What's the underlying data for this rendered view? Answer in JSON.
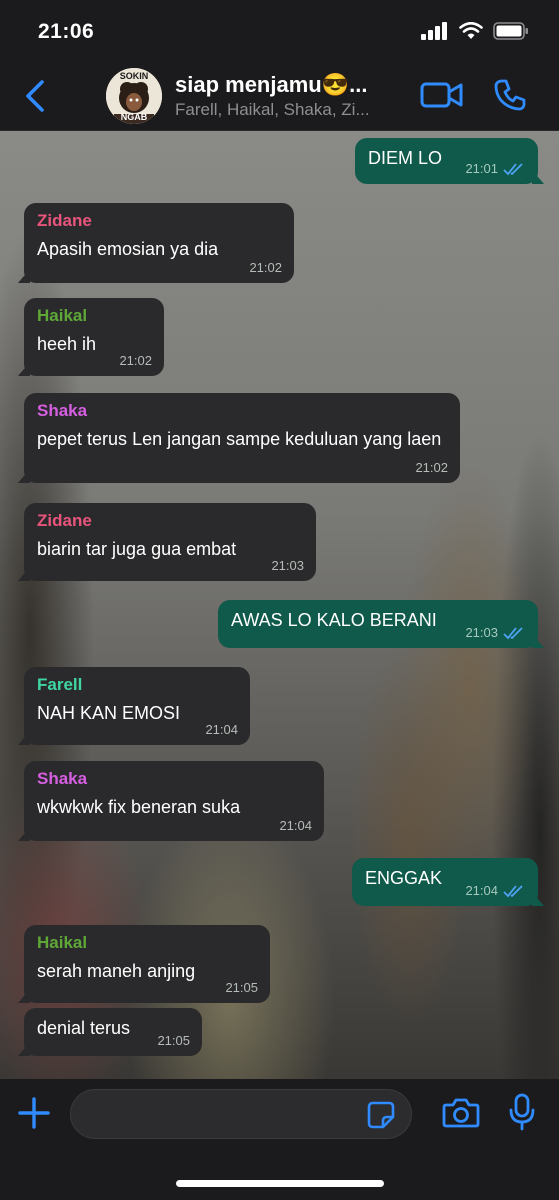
{
  "status": {
    "time": "21:06"
  },
  "header": {
    "title": "siap menjamu😎...",
    "subtitle": "Farell, Haikal, Shaka, Zi...",
    "avatar_text_top": "SOKIN",
    "avatar_text_bottom": "NGAB"
  },
  "messages": [
    {
      "direction": "out",
      "text": "DIEM LO",
      "time": "21:01"
    },
    {
      "direction": "in",
      "sender": "Zidane",
      "text": "Apasih emosian ya dia",
      "time": "21:02"
    },
    {
      "direction": "in",
      "sender": "Haikal",
      "text": "heeh ih",
      "time": "21:02"
    },
    {
      "direction": "in",
      "sender": "Shaka",
      "text": "pepet terus Len jangan sampe keduluan yang laen",
      "time": "21:02"
    },
    {
      "direction": "in",
      "sender": "Zidane",
      "text": "biarin tar juga gua embat",
      "time": "21:03"
    },
    {
      "direction": "out",
      "text": "AWAS LO KALO BERANI",
      "time": "21:03"
    },
    {
      "direction": "in",
      "sender": "Farell",
      "text": "NAH KAN EMOSI",
      "time": "21:04"
    },
    {
      "direction": "in",
      "sender": "Shaka",
      "text": "wkwkwk fix beneran suka",
      "time": "21:04"
    },
    {
      "direction": "out",
      "text": "ENGGAK",
      "time": "21:04"
    },
    {
      "direction": "in",
      "sender": "Haikal",
      "text": "serah maneh anjing",
      "time": "21:05"
    },
    {
      "direction": "in",
      "text": "denial terus",
      "time": "21:05"
    }
  ],
  "sender_colors": {
    "Zidane": "#e8547c",
    "Haikal": "#5fa838",
    "Shaka": "#d65ee0",
    "Farell": "#3fd6a2"
  },
  "colors": {
    "accent": "#2f8bff",
    "tick": "#4fa3f7",
    "bubble_in": "#2a2a2c",
    "bubble_out": "#0f5a4a"
  },
  "input": {
    "placeholder": ""
  },
  "icons": {
    "back": "chevron-left-icon",
    "video": "video-call-icon",
    "phone": "phone-icon",
    "plus": "plus-icon",
    "sticker": "sticker-icon",
    "camera": "camera-icon",
    "mic": "microphone-icon"
  }
}
